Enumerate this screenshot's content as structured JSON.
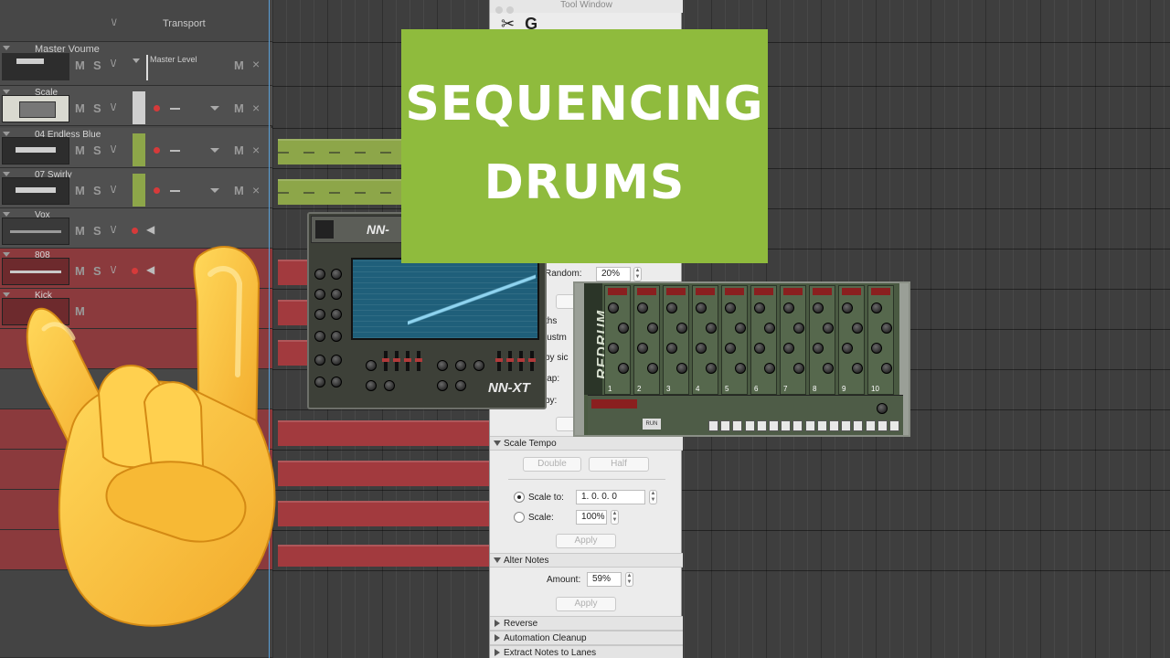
{
  "title_card": {
    "line1": "SEQUENCING",
    "line2": "DRUMS"
  },
  "sequencer": {
    "transport_label": "Transport",
    "master": {
      "name": "Master Voume",
      "level_label": "Master Level",
      "mute": "M",
      "close": "×"
    },
    "tracks": [
      {
        "name": "Scale",
        "color": "#4a4a4a",
        "kind": "instrument"
      },
      {
        "name": "04 Endless Blue",
        "color": "#8da649",
        "kind": "green"
      },
      {
        "name": "07 Swirly",
        "color": "#8da649",
        "kind": "green"
      },
      {
        "name": "Vox",
        "color": "#505050",
        "kind": "audio"
      },
      {
        "name": "808",
        "color": "#a23a3e",
        "kind": "red"
      },
      {
        "name": "Kick",
        "color": "#a23a3e",
        "kind": "red"
      }
    ],
    "track_buttons": {
      "mute": "M",
      "solo": "S"
    },
    "colors": {
      "green_clip": "#8da649",
      "red_clip": "#a23a3e",
      "playhead": "#5aa0d8"
    }
  },
  "tool_window": {
    "title": "Tool Window",
    "random_label": "Random:",
    "random_value": "20%",
    "partial_label_lengths": "ths",
    "partial_label_adjustment": "justm",
    "partial_label_side": "by sic",
    "partial_label_overlap": "lap:",
    "partial_label_by": "by:",
    "scale_tempo": {
      "header": "Scale Tempo",
      "double": "Double",
      "half": "Half",
      "scale_to_label": "Scale to:",
      "scale_to_value": "1.  0.  0.    0",
      "scale_label": "Scale:",
      "scale_value": "100%",
      "apply": "Apply"
    },
    "alter_notes": {
      "header": "Alter Notes",
      "amount_label": "Amount:",
      "amount_value": "59%",
      "apply": "Apply"
    },
    "collapsed_sections": [
      "Reverse",
      "Automation Cleanup",
      "Extract Notes to Lanes"
    ]
  },
  "nnxt": {
    "logo": "NN-XT",
    "logo_small": "NN-"
  },
  "redrum": {
    "brand": "REDRUM",
    "channel_numbers": [
      "1",
      "2",
      "3",
      "4",
      "5",
      "6",
      "7",
      "8",
      "9",
      "10"
    ],
    "run_label": "RUN"
  },
  "icons": {
    "tool_icons": [
      "scissors-icon",
      "g-icon"
    ],
    "hand": "sign-of-the-horns-emoji"
  }
}
